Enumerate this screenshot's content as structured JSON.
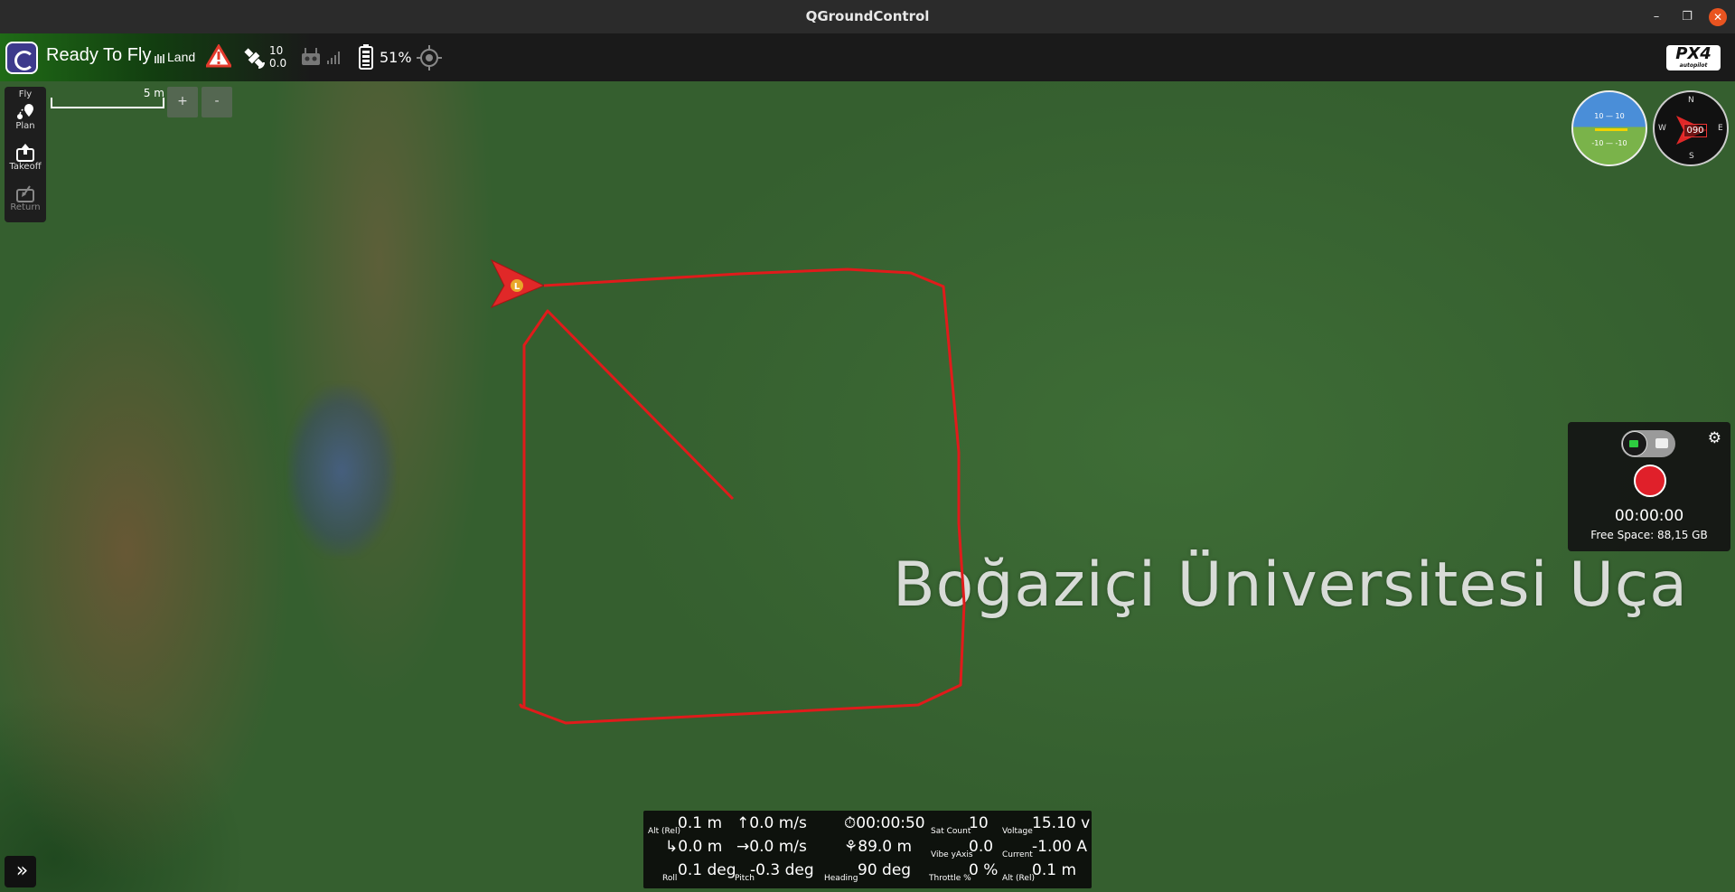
{
  "window": {
    "title": "QGroundControl",
    "minimize": "–",
    "maximize": "❐",
    "close": "✕"
  },
  "toolbar": {
    "status": "Ready To Fly",
    "flight_mode": "Land",
    "gps": {
      "sat_count": "10",
      "hdop": "0.0"
    },
    "battery": "51%",
    "brand": "PX4",
    "brand_sub": "autopilot",
    "icons": [
      "qgc-logo-icon",
      "flight-mode-icon",
      "warning-icon",
      "gps-satellite-icon",
      "rc-transmitter-icon",
      "signal-strength-icon",
      "battery-icon",
      "gps-rtk-icon",
      "px4-logo"
    ],
    "colors": {
      "ready_gradient": "#1f6b16",
      "warning": "#e33a2c"
    }
  },
  "toolstrip": {
    "items": [
      {
        "label": "Fly",
        "icon": "fly-icon"
      },
      {
        "label": "Plan",
        "icon": "plan-icon"
      },
      {
        "label": "Takeoff",
        "icon": "takeoff-icon"
      },
      {
        "label": "Return",
        "icon": "return-icon"
      }
    ]
  },
  "map": {
    "scale_label": "5 m",
    "zoom_in": "+",
    "zoom_out": "-",
    "watermark": "Boğaziçi Üniversitesi Uça",
    "vehicle_marker": "L",
    "track_color": "#e01b1b"
  },
  "instruments": {
    "attitude": {
      "pitch_up": "10 — 10",
      "pitch_down": "-10 — -10"
    },
    "compass": {
      "n": "N",
      "e": "E",
      "s": "S",
      "w": "W",
      "heading": "090"
    }
  },
  "camera": {
    "elapsed": "00:00:00",
    "free_space": "Free Space: 88,15 GB",
    "mode": "video",
    "record_color": "#e0202a"
  },
  "telemetry": {
    "alt_rel_label": "Alt (Rel)",
    "alt_rel": "0.1 m",
    "climb_rate_icon": "↑",
    "climb_rate": "0.0 m/s",
    "flight_time": "00:00:50",
    "sat_count_label": "Sat Count",
    "sat_count": "10",
    "voltage_label": "Voltage",
    "voltage": "15.10 v",
    "dist_home": "0.0 m",
    "ground_speed": "0.0 m/s",
    "dist_start": "89.0 m",
    "vibe_label": "Vibe yAxis",
    "vibe": "0.0",
    "current_label": "Current",
    "current": "-1.00 A",
    "roll_label": "Roll",
    "roll": "0.1 deg",
    "pitch_label": "Pitch",
    "pitch": "-0.3 deg",
    "heading_label": "Heading",
    "heading": "90 deg",
    "throttle_label": "Throttle %",
    "throttle": "0 %",
    "alt_rel2_label": "Alt (Rel)",
    "alt_rel2": "0.1 m"
  },
  "collapse": "»"
}
